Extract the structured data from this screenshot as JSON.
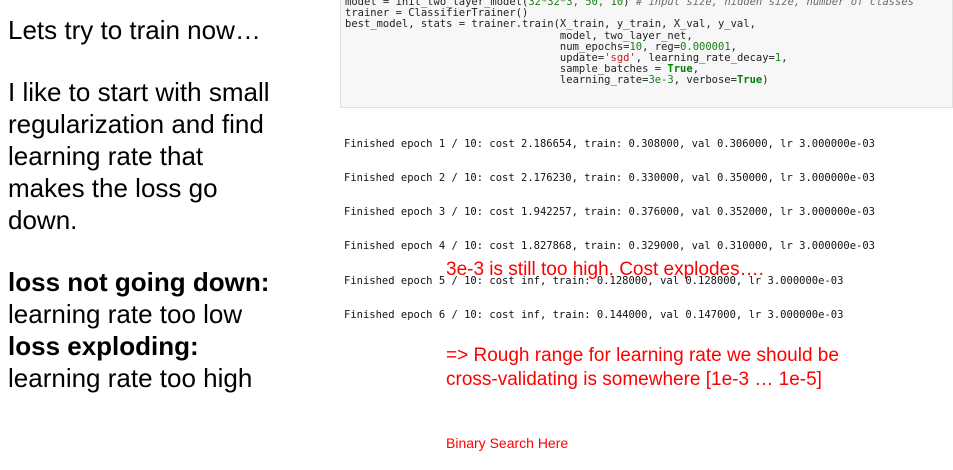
{
  "left_text": {
    "line1": "Lets try to train now…",
    "para2": [
      "I like to start with small",
      "regularization and find",
      "learning rate that",
      "makes the loss go",
      "down."
    ],
    "bold1": "loss not going down:",
    "plain1": "learning rate too low",
    "bold2": "loss exploding:",
    "plain2": "learning rate too high"
  },
  "code": {
    "l1_pre": "model = init_two_layer_model(",
    "l1_args": "32*32*3, 50, 10",
    "l1_close": ") ",
    "l1_comment": "# input size, hidden size, number of classes",
    "l2": "trainer = ClassifierTrainer()",
    "l3": "best_model, stats = trainer.train(X_train, y_train, X_val, y_val,",
    "l4": "                                  model, two_layer_net,",
    "l5_pre": "                                  num_epochs=",
    "l5_a": "10",
    "l5_mid": ", reg=",
    "l5_b": "0.000001",
    "l5_end": ",",
    "l6_pre": "                                  update=",
    "l6_str": "'sgd'",
    "l6_mid": ", learning_rate_decay=",
    "l6_num": "1",
    "l6_end": ",",
    "l7_pre": "                                  sample_batches = ",
    "l7_kw": "True",
    "l7_end": ",",
    "l8_pre": "                                  learning_rate=",
    "l8_num": "3e-3",
    "l8_mid": ", verbose=",
    "l8_kw": "True",
    "l8_end": ")"
  },
  "output": [
    "Finished epoch 1 / 10: cost 2.186654, train: 0.308000, val 0.306000, lr 3.000000e-03",
    "Finished epoch 2 / 10: cost 2.176230, train: 0.330000, val 0.350000, lr 3.000000e-03",
    "Finished epoch 3 / 10: cost 1.942257, train: 0.376000, val 0.352000, lr 3.000000e-03",
    "Finished epoch 4 / 10: cost 1.827868, train: 0.329000, val 0.310000, lr 3.000000e-03",
    "Finished epoch 5 / 10: cost inf, train: 0.128000, val 0.128000, lr 3.000000e-03",
    "Finished epoch 6 / 10: cost inf, train: 0.144000, val 0.147000, lr 3.000000e-03"
  ],
  "notes": {
    "explodes": "3e-3 is still too high. Cost explodes….",
    "range": "=> Rough range for learning rate we should be cross-validating is somewhere [1e-3 … 1e-5]",
    "binary": "Binary Search Here"
  },
  "colors": {
    "annotation": "#ff0000",
    "code_bg": "#f7f7f7"
  }
}
